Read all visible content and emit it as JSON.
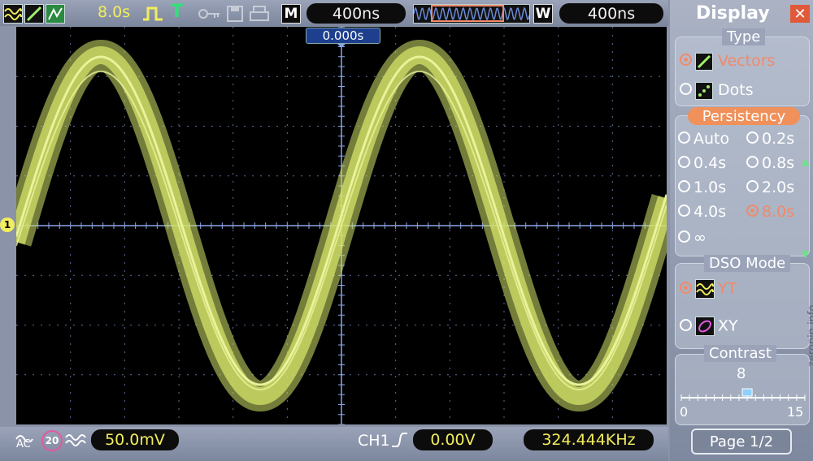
{
  "status_bar": {
    "time_per_div": "8.0s",
    "trigger_state": "T",
    "memory_badge": "M",
    "memory_time": "400ns",
    "window_badge": "W",
    "window_time": "400ns",
    "trigger_position": "0.000s"
  },
  "bottom_bar": {
    "coupling": "AC",
    "bandwidth_limit": "20",
    "volts_per_div": "50.0mV",
    "channel": "CH1",
    "trigger_level": "0.00V",
    "frequency": "324.444KHz"
  },
  "waveform": {
    "color": "#d4e36a",
    "marker_label": "1"
  },
  "display_menu": {
    "title": "Display",
    "close_icon": "close-icon",
    "type": {
      "title": "Type",
      "options": [
        "Vectors",
        "Dots"
      ],
      "selected": "Vectors"
    },
    "persistency": {
      "title": "Persistency",
      "options": [
        "Auto",
        "0.2s",
        "0.4s",
        "0.8s",
        "1.0s",
        "2.0s",
        "4.0s",
        "8.0s",
        "∞"
      ],
      "selected": "8.0s"
    },
    "dso_mode": {
      "title": "DSO Mode",
      "options": [
        "YT",
        "XY"
      ],
      "selected": "YT"
    },
    "contrast": {
      "title": "Contrast",
      "value": "8",
      "min_label": "0",
      "max_label": "15",
      "level": 8
    },
    "page": "Page 1/2"
  },
  "watermark": "zeropin.info",
  "colors": {
    "accent": "#f08a6a",
    "trace": "#d4e36a",
    "pill_text_yellow": "#f3ee5c",
    "highlight": "#f0905a"
  }
}
